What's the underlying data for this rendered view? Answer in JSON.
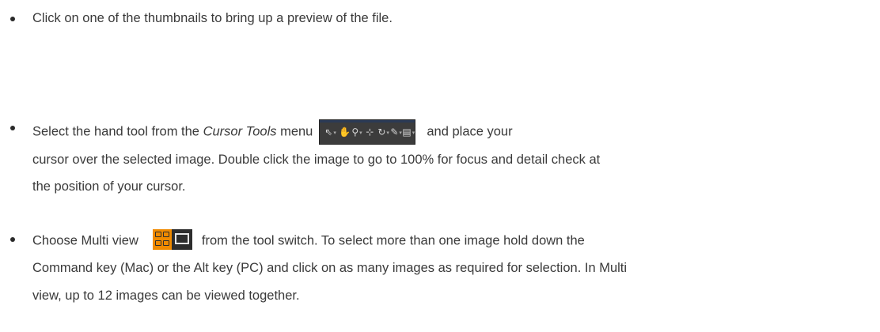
{
  "bullets": [
    {
      "text": "Click on one of the thumbnails to bring up a preview of the file."
    },
    {
      "line1_before": "Select the hand tool from the ",
      "line1_italic": "Cursor Tools",
      "line1_mid": " menu",
      "line1_after": "and place your",
      "line2": "cursor over the selected image. Double click the image to go to 100% for focus and detail check at",
      "line3": "the position of your cursor.",
      "toolbar_icons": [
        "select-arrow-icon",
        "hand-icon",
        "zoom-icon",
        "crop-icon",
        "rotate-icon",
        "picker-icon",
        "keystone-icon"
      ]
    },
    {
      "line1_before": "Choose Multi view",
      "line1_after": "from the tool switch. To select more than one image hold down the",
      "line2": "Command key (Mac) or the Alt key (PC) and click on as many images as required for selection. In Multi",
      "line3": "view, up to 12 images can be viewed together.",
      "switch_icons": [
        "multi-view-icon",
        "single-view-icon"
      ]
    }
  ],
  "colors": {
    "text": "#3a3a3a",
    "toolbar_bg": "#3c3c3c",
    "hand_tool_active": "#f0a020",
    "multi_view_active": "#f08a00"
  }
}
